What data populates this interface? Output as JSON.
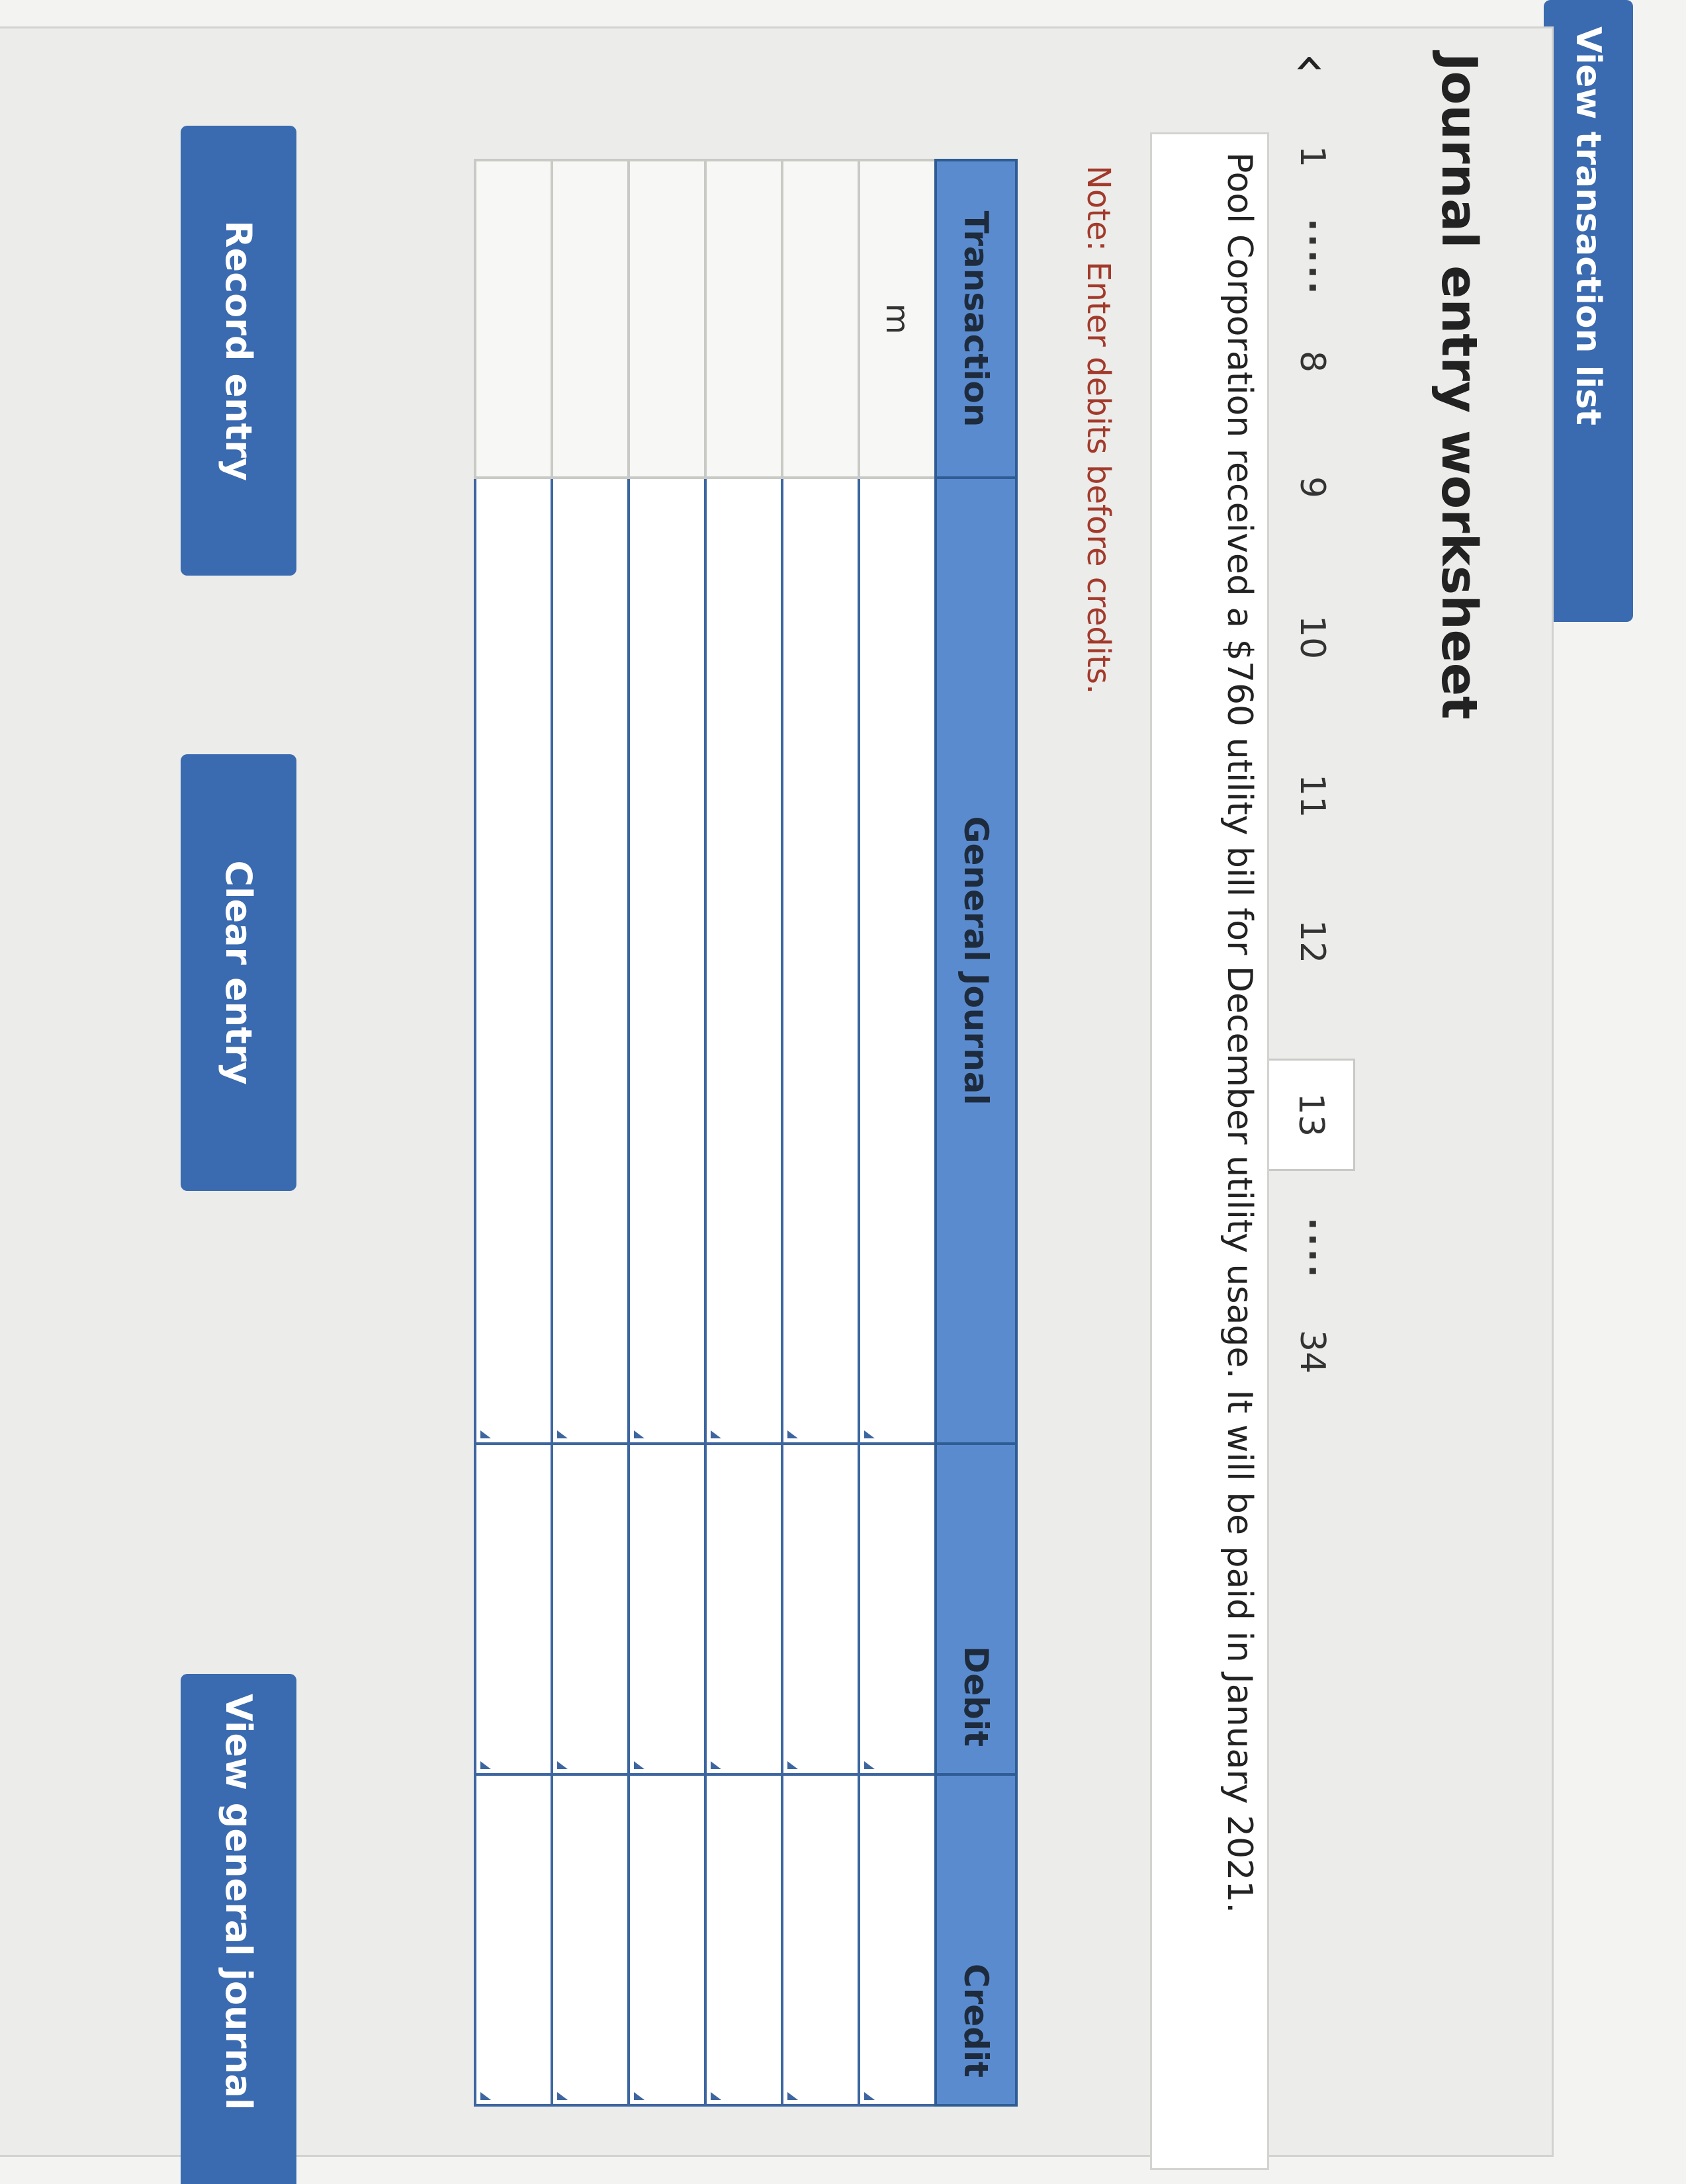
{
  "header": {
    "view_list_label": "View transaction list",
    "title": "Journal entry worksheet"
  },
  "pager": {
    "items": [
      "1",
      "8",
      "9",
      "10",
      "11",
      "12",
      "13",
      "34"
    ],
    "dots": "·····",
    "dots_short": "····",
    "active": "13"
  },
  "transaction": {
    "description": "Pool Corporation received a $760 utility bill for December utility usage. It will be paid in January 2021."
  },
  "note": "Note: Enter debits before credits.",
  "journal": {
    "columns": [
      "Transaction",
      "General Journal",
      "Debit",
      "Credit"
    ],
    "first_transaction": "m",
    "rows": [
      {
        "transaction": "m",
        "account": "",
        "debit": "",
        "credit": ""
      },
      {
        "transaction": "",
        "account": "",
        "debit": "",
        "credit": ""
      },
      {
        "transaction": "",
        "account": "",
        "debit": "",
        "credit": ""
      },
      {
        "transaction": "",
        "account": "",
        "debit": "",
        "credit": ""
      },
      {
        "transaction": "",
        "account": "",
        "debit": "",
        "credit": ""
      },
      {
        "transaction": "",
        "account": "",
        "debit": "",
        "credit": ""
      }
    ]
  },
  "buttons": {
    "record": "Record entry",
    "clear": "Clear entry",
    "view_general": "View general journal"
  },
  "colors": {
    "button_blue": "#3a6ab0",
    "header_blue": "#5b8bcf",
    "note_red": "#a23a2c"
  }
}
